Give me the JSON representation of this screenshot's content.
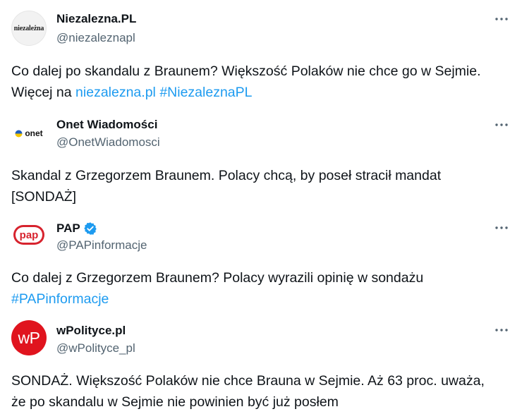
{
  "tweets": [
    {
      "display_name": "Niezalezna.PL",
      "handle": "@niezaleznapl",
      "avatar_text": "niezależna",
      "text_line1": "Co dalej po skandalu z Braunem? Większość Polaków nie chce go w Sejmie.",
      "text_prefix": "Więcej na ",
      "link": "niezalezna.pl",
      "hashtag": "#NiezaleznaPL"
    },
    {
      "display_name": "Onet Wiadomości",
      "handle": "@OnetWiadomosci",
      "avatar_text": "onet",
      "text_line1": "Skandal z Grzegorzem Braunem. Polacy chcą, by poseł stracił mandat",
      "text_line2": "[SONDAŻ]"
    },
    {
      "display_name": "PAP",
      "handle": "@PAPinformacje",
      "avatar_text": "pap",
      "text_line1": "Co dalej z Grzegorzem Braunem? Polacy wyrazili opinię w sondażu",
      "hashtag": "#PAPinformacje"
    },
    {
      "display_name": "wPolityce.pl",
      "handle": "@wPolityce_pl",
      "avatar_text": "wP",
      "text_line1": "SONDAŻ. Większość Polaków nie chce Brauna w Sejmie. Aż 63 proc. uważa,",
      "text_line2": "że po skandalu w Sejmie nie powinien być już posłem"
    }
  ],
  "colors": {
    "link": "#1d9bf0",
    "secondary_text": "#536471",
    "primary_text": "#0f1419",
    "pap_red": "#d7232e",
    "wpolityce_red": "#e0141e",
    "verified_blue": "#1d9bf0"
  },
  "icons": {
    "more": "more-horizontal-icon",
    "verified": "verified-badge-icon"
  }
}
